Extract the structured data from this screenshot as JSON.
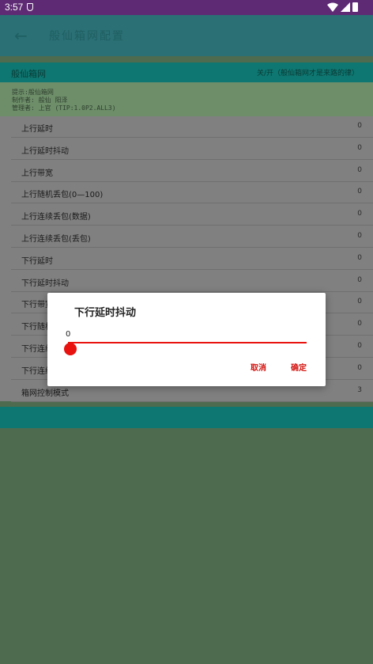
{
  "status_bar": {
    "time": "3:57",
    "icons": [
      "shield-icon",
      "wifi-icon",
      "cell-signal-icon",
      "battery-icon"
    ]
  },
  "top_bar": {
    "back_icon": "←",
    "title": "般仙箱网配置"
  },
  "header": {
    "left": "般仙箱网",
    "right": "关/开（般仙箱网才是来路的律）"
  },
  "info": {
    "line1": "提示:般仙箱网",
    "line2": "制作者: 般仙  阳泽",
    "line3": "管理者: 上官  (TIP:1.0P2.ALL3)"
  },
  "settings": [
    {
      "label": "上行延时",
      "value": "0"
    },
    {
      "label": "上行延时抖动",
      "value": "0"
    },
    {
      "label": "上行带宽",
      "value": "0"
    },
    {
      "label": "上行随机丢包(0—100)",
      "value": "0"
    },
    {
      "label": "上行连续丢包(数据)",
      "value": "0"
    },
    {
      "label": "上行连续丢包(丢包)",
      "value": "0"
    },
    {
      "label": "下行延时",
      "value": "0"
    },
    {
      "label": "下行延时抖动",
      "value": "0"
    },
    {
      "label": "下行带宽",
      "value": "0"
    },
    {
      "label": "下行随机丢包",
      "value": "0"
    },
    {
      "label": "下行连续丢包",
      "value": "0"
    },
    {
      "label": "下行连续丢包",
      "value": "0"
    },
    {
      "label": "箱网控制模式",
      "value": "3"
    }
  ],
  "dialog": {
    "title": "下行延时抖动",
    "slider_value": "0",
    "slider_fraction": 0,
    "cancel_label": "取消",
    "ok_label": "确定"
  },
  "colors": {
    "status_bar": "#5e2a74",
    "teal": "#0e7771",
    "slider_accent": "#e8120f",
    "background": "#4e6b4f"
  }
}
